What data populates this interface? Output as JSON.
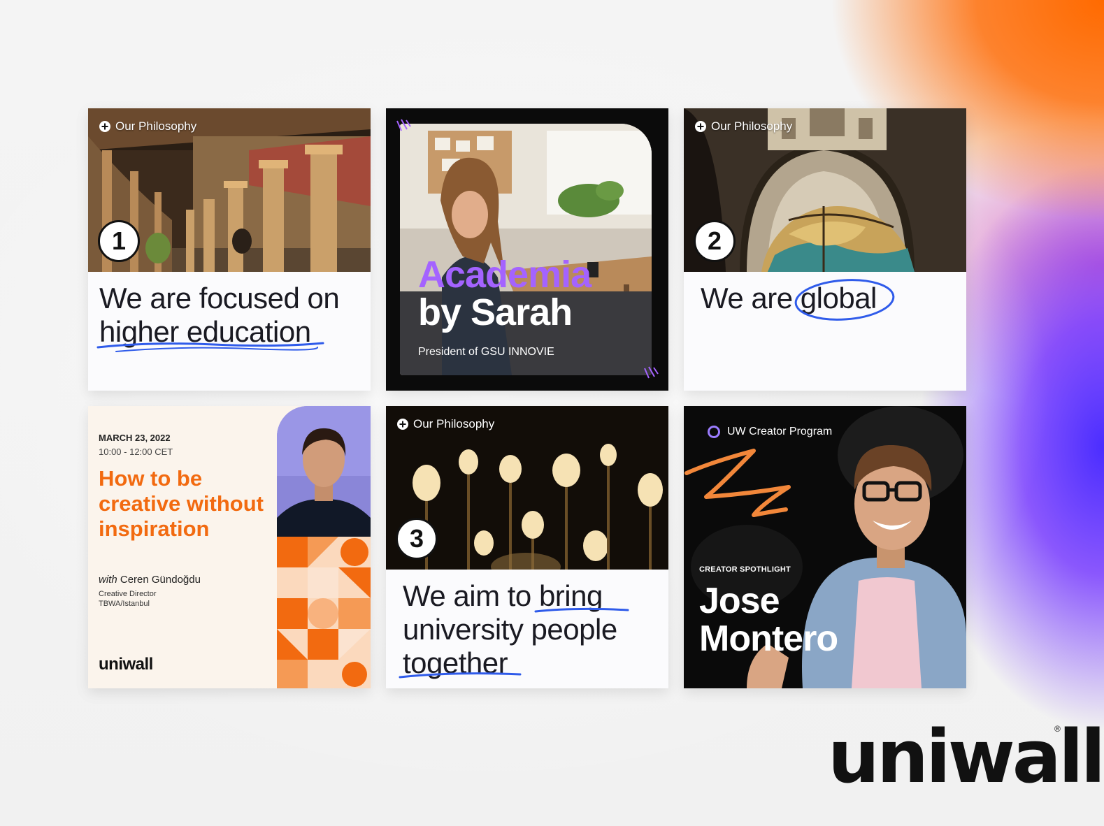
{
  "cards": {
    "card1": {
      "tag": "Our Philosophy",
      "number": "1",
      "line1": "We are focused on",
      "line2": "higher education"
    },
    "card2": {
      "title1": "Academia",
      "title2": "by Sarah",
      "subtitle": "President of GSU INNOVIE"
    },
    "card3": {
      "tag": "Our Philosophy",
      "number": "2",
      "text_pre": "We are",
      "text_circled": "global"
    },
    "card4": {
      "date": "MARCH 23, 2022",
      "time": "10:00 - 12:00 CET",
      "title": "How to be creative without inspiration",
      "with_prefix": "with",
      "speaker": "Ceren Gündoğdu",
      "role_line1": "Creative Director",
      "role_line2": "TBWA/Istanbul",
      "brand": "uniwall"
    },
    "card5": {
      "tag": "Our Philosophy",
      "number": "3",
      "line1": "We aim to bring",
      "line2": "university people",
      "line3": "together"
    },
    "card6": {
      "program": "UW Creator Program",
      "spotlight": "CREATOR SPOTHLIGHT",
      "first_name": "Jose",
      "last_name": "Montero"
    }
  },
  "logo": {
    "text": "uniwall",
    "registered": "®"
  },
  "colors": {
    "orange": "#f26a10",
    "purple": "#a463ff",
    "blue_scribble": "#2f5bea",
    "dark": "#111111"
  },
  "icons": [
    "plus-circle-icon",
    "ring-icon"
  ]
}
